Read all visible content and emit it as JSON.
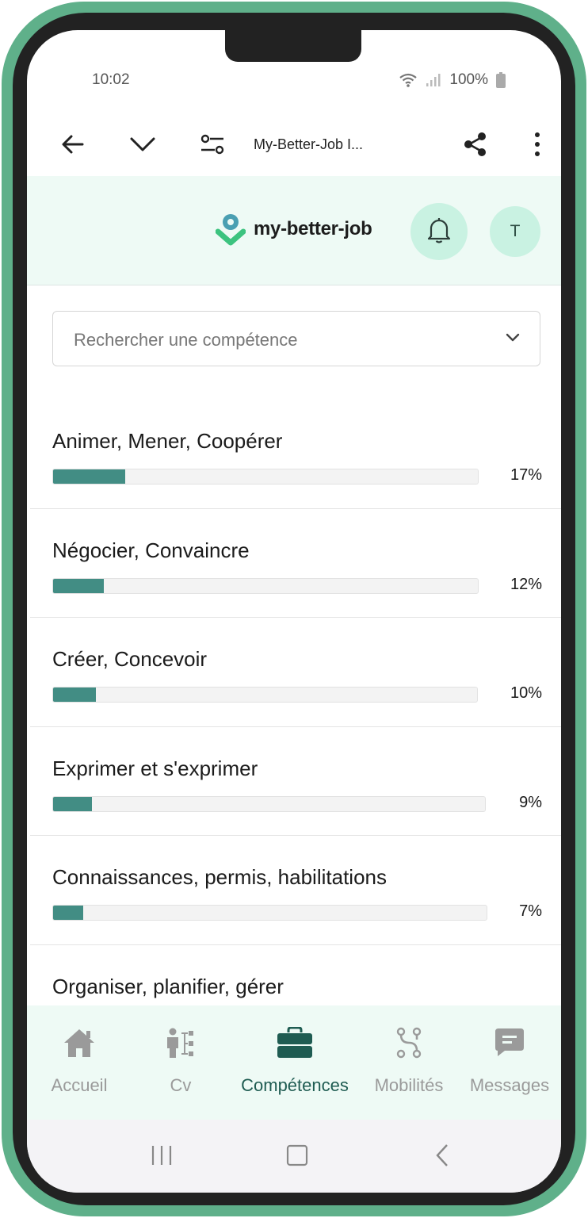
{
  "status": {
    "time": "10:02",
    "battery": "100%"
  },
  "browser": {
    "title": "My-Better-Job I..."
  },
  "header": {
    "logo_text": "my-better-job",
    "avatar_initial": "T"
  },
  "search": {
    "placeholder": "Rechercher une compétence"
  },
  "skills": [
    {
      "name": "Animer, Mener, Coopérer",
      "percent_label": "17%",
      "value": 17
    },
    {
      "name": "Négocier, Convaincre",
      "percent_label": "12%",
      "value": 12
    },
    {
      "name": "Créer, Concevoir",
      "percent_label": "10%",
      "value": 10
    },
    {
      "name": "Exprimer et s'exprimer",
      "percent_label": "9%",
      "value": 9
    },
    {
      "name": "Connaissances, permis, habilitations",
      "percent_label": "7%",
      "value": 7
    },
    {
      "name": "Organiser, planifier, gérer",
      "percent_label": "",
      "value": null
    }
  ],
  "nav": [
    {
      "label": "Accueil",
      "icon": "home-icon",
      "active": false
    },
    {
      "label": "Cv",
      "icon": "cv-icon",
      "active": false
    },
    {
      "label": "Compétences",
      "icon": "briefcase-icon",
      "active": true
    },
    {
      "label": "Mobilités",
      "icon": "mobility-icon",
      "active": false
    },
    {
      "label": "Messages",
      "icon": "message-icon",
      "active": false
    }
  ],
  "colors": {
    "accent": "#428d84",
    "header_bg": "#eefaf5",
    "chip_bg": "#c9f2e2",
    "frame": "#5fb08a",
    "active_nav": "#1f5c52"
  }
}
